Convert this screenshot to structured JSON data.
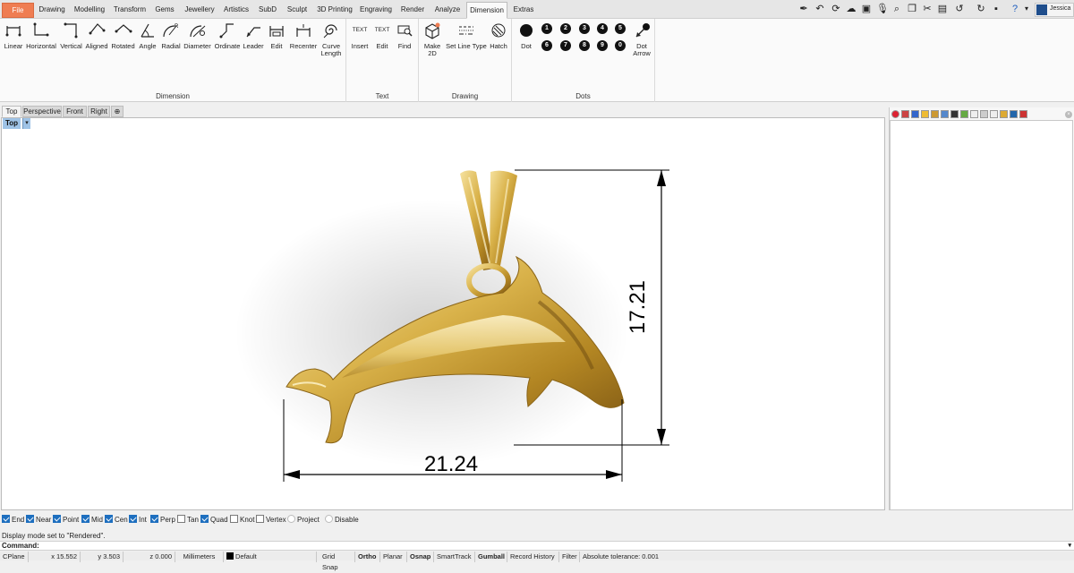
{
  "menu": {
    "tabs": [
      "File",
      "Drawing",
      "Modelling",
      "Transform",
      "Gems",
      "Jewellery",
      "Artistics",
      "SubD",
      "Sculpt",
      "3D Printing",
      "Engraving",
      "Render",
      "Analyze",
      "Dimension",
      "Extras"
    ],
    "active_tab": "Dimension",
    "user_name": "Jessica"
  },
  "ribbon": {
    "groups": {
      "dimension": {
        "title": "Dimension",
        "buttons": [
          "Linear",
          "Horizontal",
          "Vertical",
          "Aligned",
          "Rotated",
          "Angle",
          "Radial",
          "Diameter",
          "Ordinate",
          "Leader",
          "Edit",
          "Recenter",
          "Curve Length"
        ]
      },
      "text": {
        "title": "Text",
        "buttons": [
          "Insert",
          "Edit",
          "Find"
        ],
        "icon_text": "TEXT"
      },
      "drawing": {
        "title": "Drawing",
        "buttons": [
          "Make 2D",
          "Set Line Type",
          "Hatch"
        ]
      },
      "dots": {
        "title": "Dots",
        "dot_label": "Dot",
        "dot_arrow_label": "Dot Arrow",
        "numbers_top": [
          "1",
          "2",
          "3",
          "4",
          "5"
        ],
        "numbers_bottom": [
          "6",
          "7",
          "8",
          "9",
          "0"
        ]
      }
    }
  },
  "viewport": {
    "tabs": [
      "Top",
      "Perspective",
      "Front",
      "Right"
    ],
    "active": "Top",
    "label": "Top",
    "dimension_horizontal": "21.24",
    "dimension_vertical": "17.21"
  },
  "osnap": [
    {
      "label": "End",
      "checked": true
    },
    {
      "label": "Near",
      "checked": true
    },
    {
      "label": "Point",
      "checked": true
    },
    {
      "label": "Mid",
      "checked": true
    },
    {
      "label": "Cen",
      "checked": true
    },
    {
      "label": "Int",
      "checked": true
    },
    {
      "label": "Perp",
      "checked": true
    },
    {
      "label": "Tan",
      "checked": false
    },
    {
      "label": "Quad",
      "checked": true
    },
    {
      "label": "Knot",
      "checked": false
    },
    {
      "label": "Vertex",
      "checked": false
    },
    {
      "label": "Project",
      "checked": false
    },
    {
      "label": "Disable",
      "checked": false
    }
  ],
  "command": {
    "history": "Display mode set to \"Rendered\".",
    "prompt": "Command:"
  },
  "status": {
    "cplane": "CPlane",
    "x": "x 15.552",
    "y": "y 3.503",
    "z": "z 0.000",
    "units": "Millimeters",
    "layer": "Default",
    "grid_snap": "Grid Snap",
    "ortho": "Ortho",
    "planar": "Planar",
    "osnap": "Osnap",
    "smarttrack": "SmartTrack",
    "gumball": "Gumball",
    "record_history": "Record History",
    "filter": "Filter",
    "tolerance": "Absolute tolerance: 0.001"
  },
  "colors": {
    "file_tab": "#ef7d52",
    "viewport_label": "#9fc3e6",
    "checkbox_on": "#1e6fbf",
    "gold": "#c9a237"
  }
}
